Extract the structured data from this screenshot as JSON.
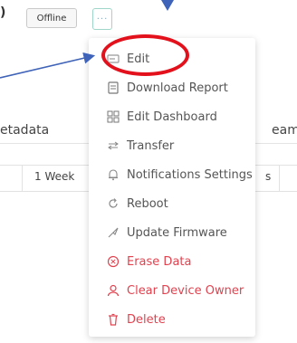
{
  "header": {
    "status_badge": "Offline",
    "more_button_label": "···",
    "left_glyph": ")"
  },
  "background": {
    "tab_left": "etadata",
    "tab_right": "eam",
    "seg_week": "1 Week",
    "seg_right": "s"
  },
  "menu": {
    "items": [
      {
        "label": "Edit",
        "icon": "edit-icon"
      },
      {
        "label": "Download Report",
        "icon": "download-report-icon"
      },
      {
        "label": "Edit Dashboard",
        "icon": "edit-dashboard-icon"
      },
      {
        "label": "Transfer",
        "icon": "transfer-icon"
      },
      {
        "label": "Notifications Settings",
        "icon": "bell-icon"
      },
      {
        "label": "Reboot",
        "icon": "reboot-icon"
      },
      {
        "label": "Update Firmware",
        "icon": "rocket-icon"
      },
      {
        "label": "Erase Data",
        "icon": "erase-icon"
      },
      {
        "label": "Clear Device Owner",
        "icon": "user-icon"
      },
      {
        "label": "Delete",
        "icon": "trash-icon"
      }
    ]
  },
  "colors": {
    "danger": "#e0434f",
    "annotation_red": "#e3111b",
    "annotation_arrow": "#3f63b8"
  }
}
